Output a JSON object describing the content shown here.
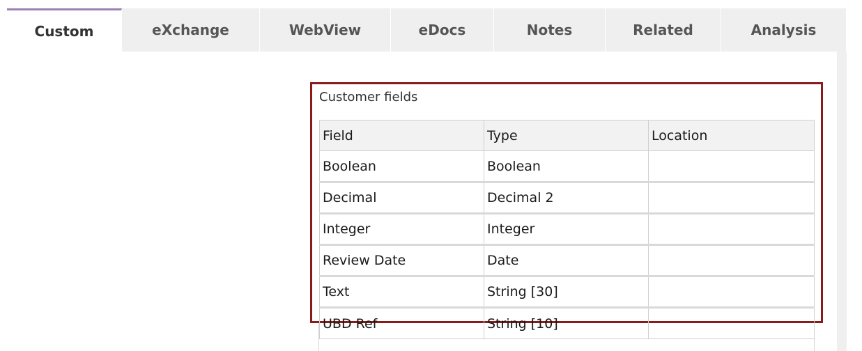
{
  "tabs": [
    {
      "label": "Custom",
      "active": true
    },
    {
      "label": "eXchange",
      "active": false
    },
    {
      "label": "WebView",
      "active": false
    },
    {
      "label": "eDocs",
      "active": false
    },
    {
      "label": "Notes",
      "active": false
    },
    {
      "label": "Related",
      "active": false
    },
    {
      "label": "Analysis",
      "active": false
    }
  ],
  "customer_fields": {
    "title": "Customer fields",
    "columns": [
      "Field",
      "Type",
      "Location"
    ],
    "rows": [
      [
        "Boolean",
        "Boolean",
        ""
      ],
      [
        "Decimal",
        "Decimal 2",
        ""
      ],
      [
        "Integer",
        "Integer",
        ""
      ],
      [
        "Review Date",
        "Date",
        ""
      ],
      [
        "Text",
        "String [30]",
        ""
      ],
      [
        "UBD Ref",
        "String [10]",
        ""
      ]
    ]
  },
  "colors": {
    "active_tab_accent": "#9b7fb5",
    "highlight_border": "#8b1a1a",
    "tab_background": "#efefef"
  }
}
